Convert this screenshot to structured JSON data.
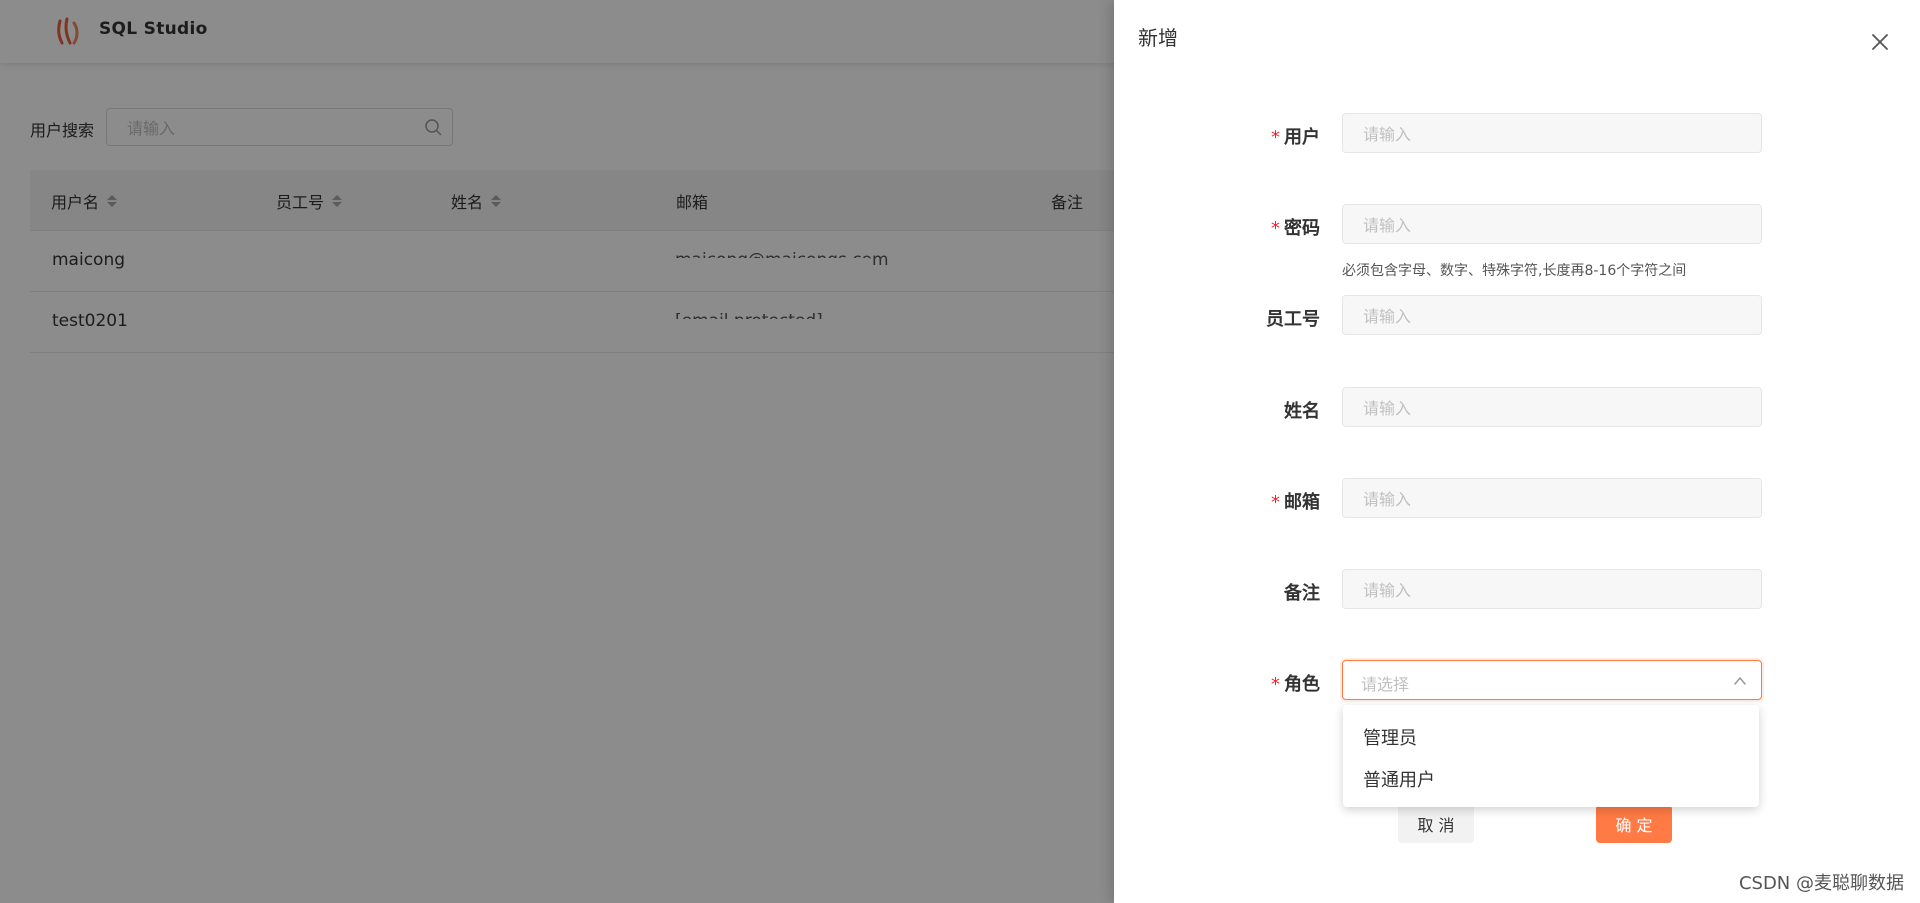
{
  "app": {
    "title": "SQL Studio",
    "search_label": "用户搜索",
    "search_placeholder": "请输入"
  },
  "table": {
    "columns": [
      "用户名",
      "员工号",
      "姓名",
      "邮箱",
      "备注"
    ],
    "rows": [
      {
        "username": "maicong",
        "email": "maicong@maicongs.com"
      },
      {
        "username": "test0201",
        "email": "[email protected]"
      }
    ]
  },
  "drawer": {
    "title": "新增",
    "fields": {
      "user": {
        "label": "用户",
        "placeholder": "请输入",
        "required": true
      },
      "password": {
        "label": "密码",
        "placeholder": "请输入",
        "required": true,
        "hint": "必须包含字母、数字、特殊字符,长度再8-16个字符之间"
      },
      "employee_no": {
        "label": "员工号",
        "placeholder": "请输入",
        "required": false
      },
      "name": {
        "label": "姓名",
        "placeholder": "请输入",
        "required": false
      },
      "email": {
        "label": "邮箱",
        "placeholder": "请输入",
        "required": true
      },
      "remark": {
        "label": "备注",
        "placeholder": "请输入",
        "required": false
      },
      "role": {
        "label": "角色",
        "placeholder": "请选择",
        "required": true
      }
    },
    "required_mark": "*",
    "role_options": [
      "管理员",
      "普通用户"
    ],
    "cancel_label": "取 消",
    "ok_label": "确 定"
  },
  "colors": {
    "accent": "#ff7a45",
    "required": "#f5222d",
    "mask": "rgba(0,0,0,0.45)"
  },
  "watermark": "CSDN @麦聪聊数据"
}
